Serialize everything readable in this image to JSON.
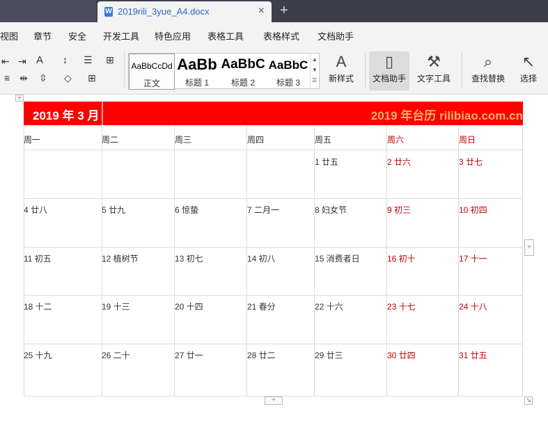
{
  "tabs": {
    "doc_title": "2019rili_3yue_A4.docx",
    "new_tab": "+",
    "close": "×"
  },
  "menu": [
    "视图",
    "章节",
    "安全",
    "开发工具",
    "特色应用",
    "表格工具",
    "表格样式",
    "文档助手"
  ],
  "ribbon": {
    "styles": [
      {
        "sample": "AaBbCcDd",
        "label": "正文"
      },
      {
        "sample": "AaBb",
        "label": "标题 1"
      },
      {
        "sample": "AaBbC",
        "label": "标题 2"
      },
      {
        "sample": "AaBbC",
        "label": "标题 3"
      }
    ],
    "new_style": "新样式",
    "doc_assistant": "文档助手",
    "text_tools": "文字工具",
    "find_replace": "查找替换",
    "select": "选择"
  },
  "calendar": {
    "month_title": "2019 年 3 月",
    "brand": "2019 年台历   rilibiao.com.cn",
    "weekdays": [
      "周一",
      "周二",
      "周三",
      "周四",
      "周五",
      "周六",
      "周日"
    ],
    "weeks": [
      [
        "",
        "",
        "",
        "",
        "1 廿五",
        "2 廿六",
        "3 廿七"
      ],
      [
        "4 廿八",
        "5 廿九",
        "6 惊蛰",
        "7 二月一",
        "8 妇女节",
        "9 初三",
        "10 初四"
      ],
      [
        "11 初五",
        "12 植树节",
        "13 初七",
        "14 初八",
        "15 消费者日",
        "16 初十",
        "17 十一"
      ],
      [
        "18 十二",
        "19 十三",
        "20 十四",
        "21 春分",
        "22 十六",
        "23 十七",
        "24 十八"
      ],
      [
        "25 十九",
        "26 二十",
        "27 廿一",
        "28 廿二",
        "29 廿三",
        "30 廿四",
        "31 廿五"
      ]
    ],
    "colors": {
      "header_bg": "#ff0000",
      "brand": "#f6b26b",
      "weekend": "#c00000"
    }
  }
}
